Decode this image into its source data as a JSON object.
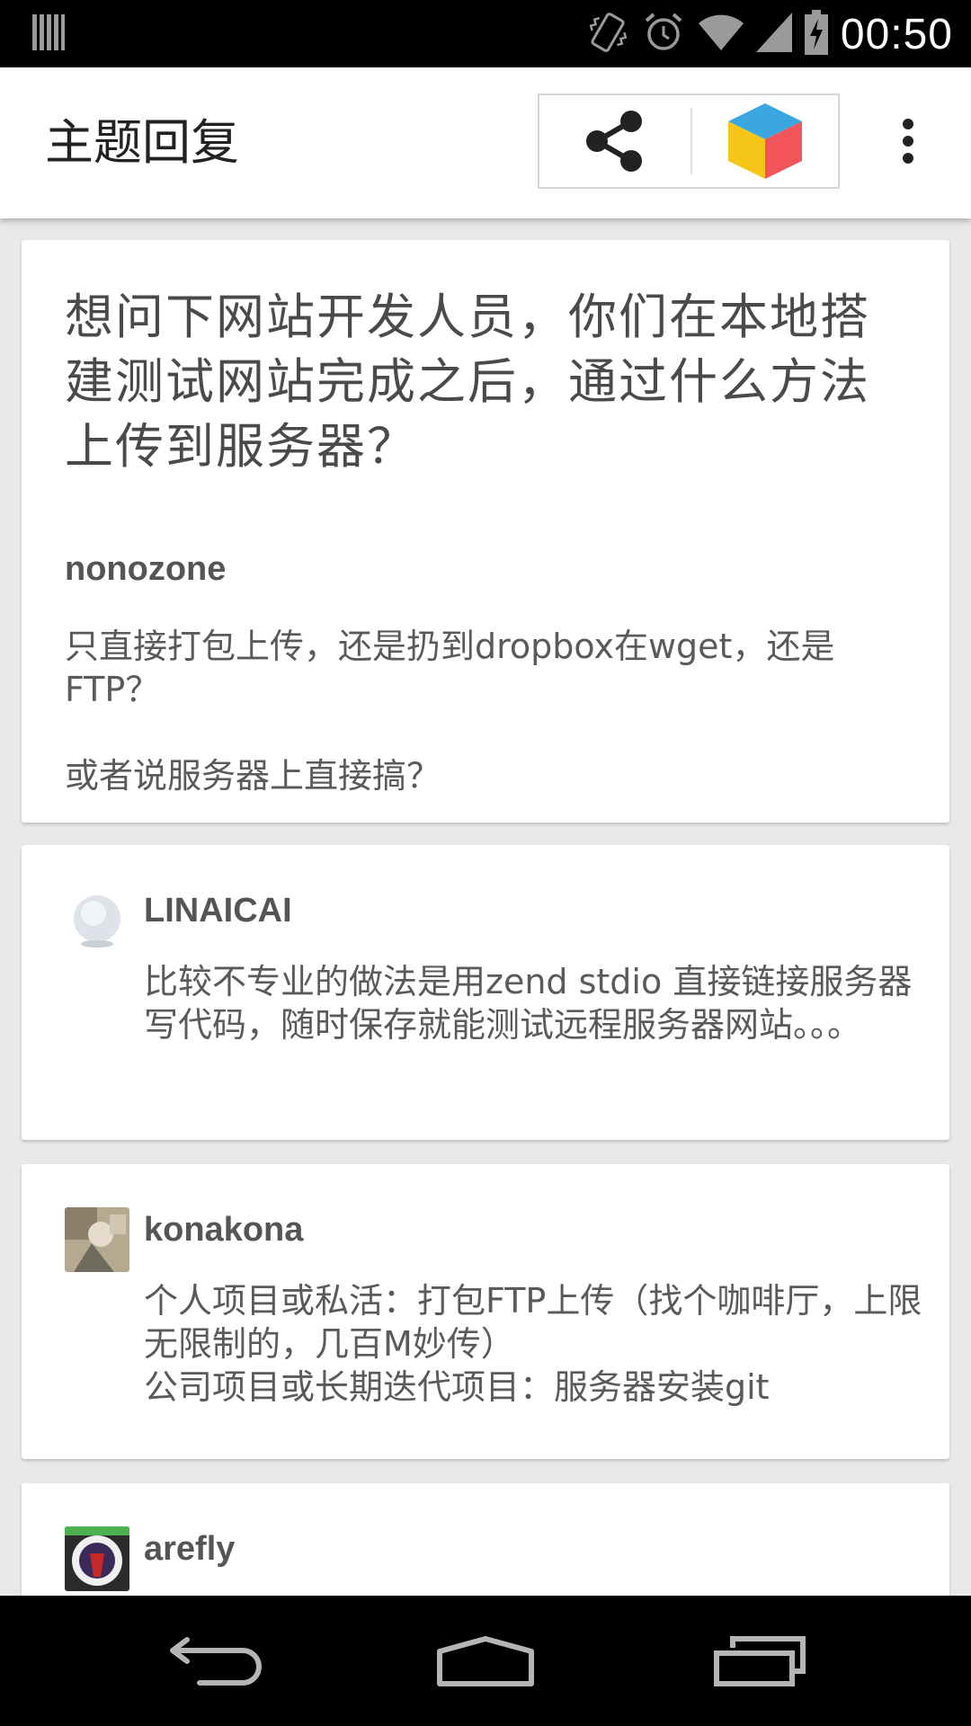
{
  "status_bar": {
    "time": "00:50",
    "icons": [
      "notification-bars-icon",
      "vibrate-icon",
      "alarm-icon",
      "wifi-icon",
      "signal-icon",
      "battery-charging-icon"
    ]
  },
  "app_bar": {
    "title": "主题回复",
    "actions": [
      "share-icon",
      "app-cube-icon",
      "more-vert-icon"
    ]
  },
  "topic": {
    "title": "想问下网站开发人员，你们在本地搭建测试网站完成之后，通过什么方法上传到服务器？",
    "author": "nonozone",
    "body": [
      "只直接打包上传，还是扔到dropbox在wget，还是FTP？",
      "或者说服务器上直接搞？"
    ]
  },
  "replies": [
    {
      "username": "LINAICAI",
      "body": [
        "比较不专业的做法是用zend stdio 直接链接服务器写代码，随时保存就能测试远程服务器网站。。。"
      ]
    },
    {
      "username": "konakona",
      "body": [
        "个人项目或私活：打包FTP上传（找个咖啡厅，上限无限制的，几百M妙传）",
        "公司项目或长期迭代项目：服务器安装git"
      ]
    },
    {
      "username": "arefly",
      "body": []
    }
  ],
  "nav_bar": {
    "buttons": [
      "back-icon",
      "home-icon",
      "recents-icon"
    ]
  }
}
